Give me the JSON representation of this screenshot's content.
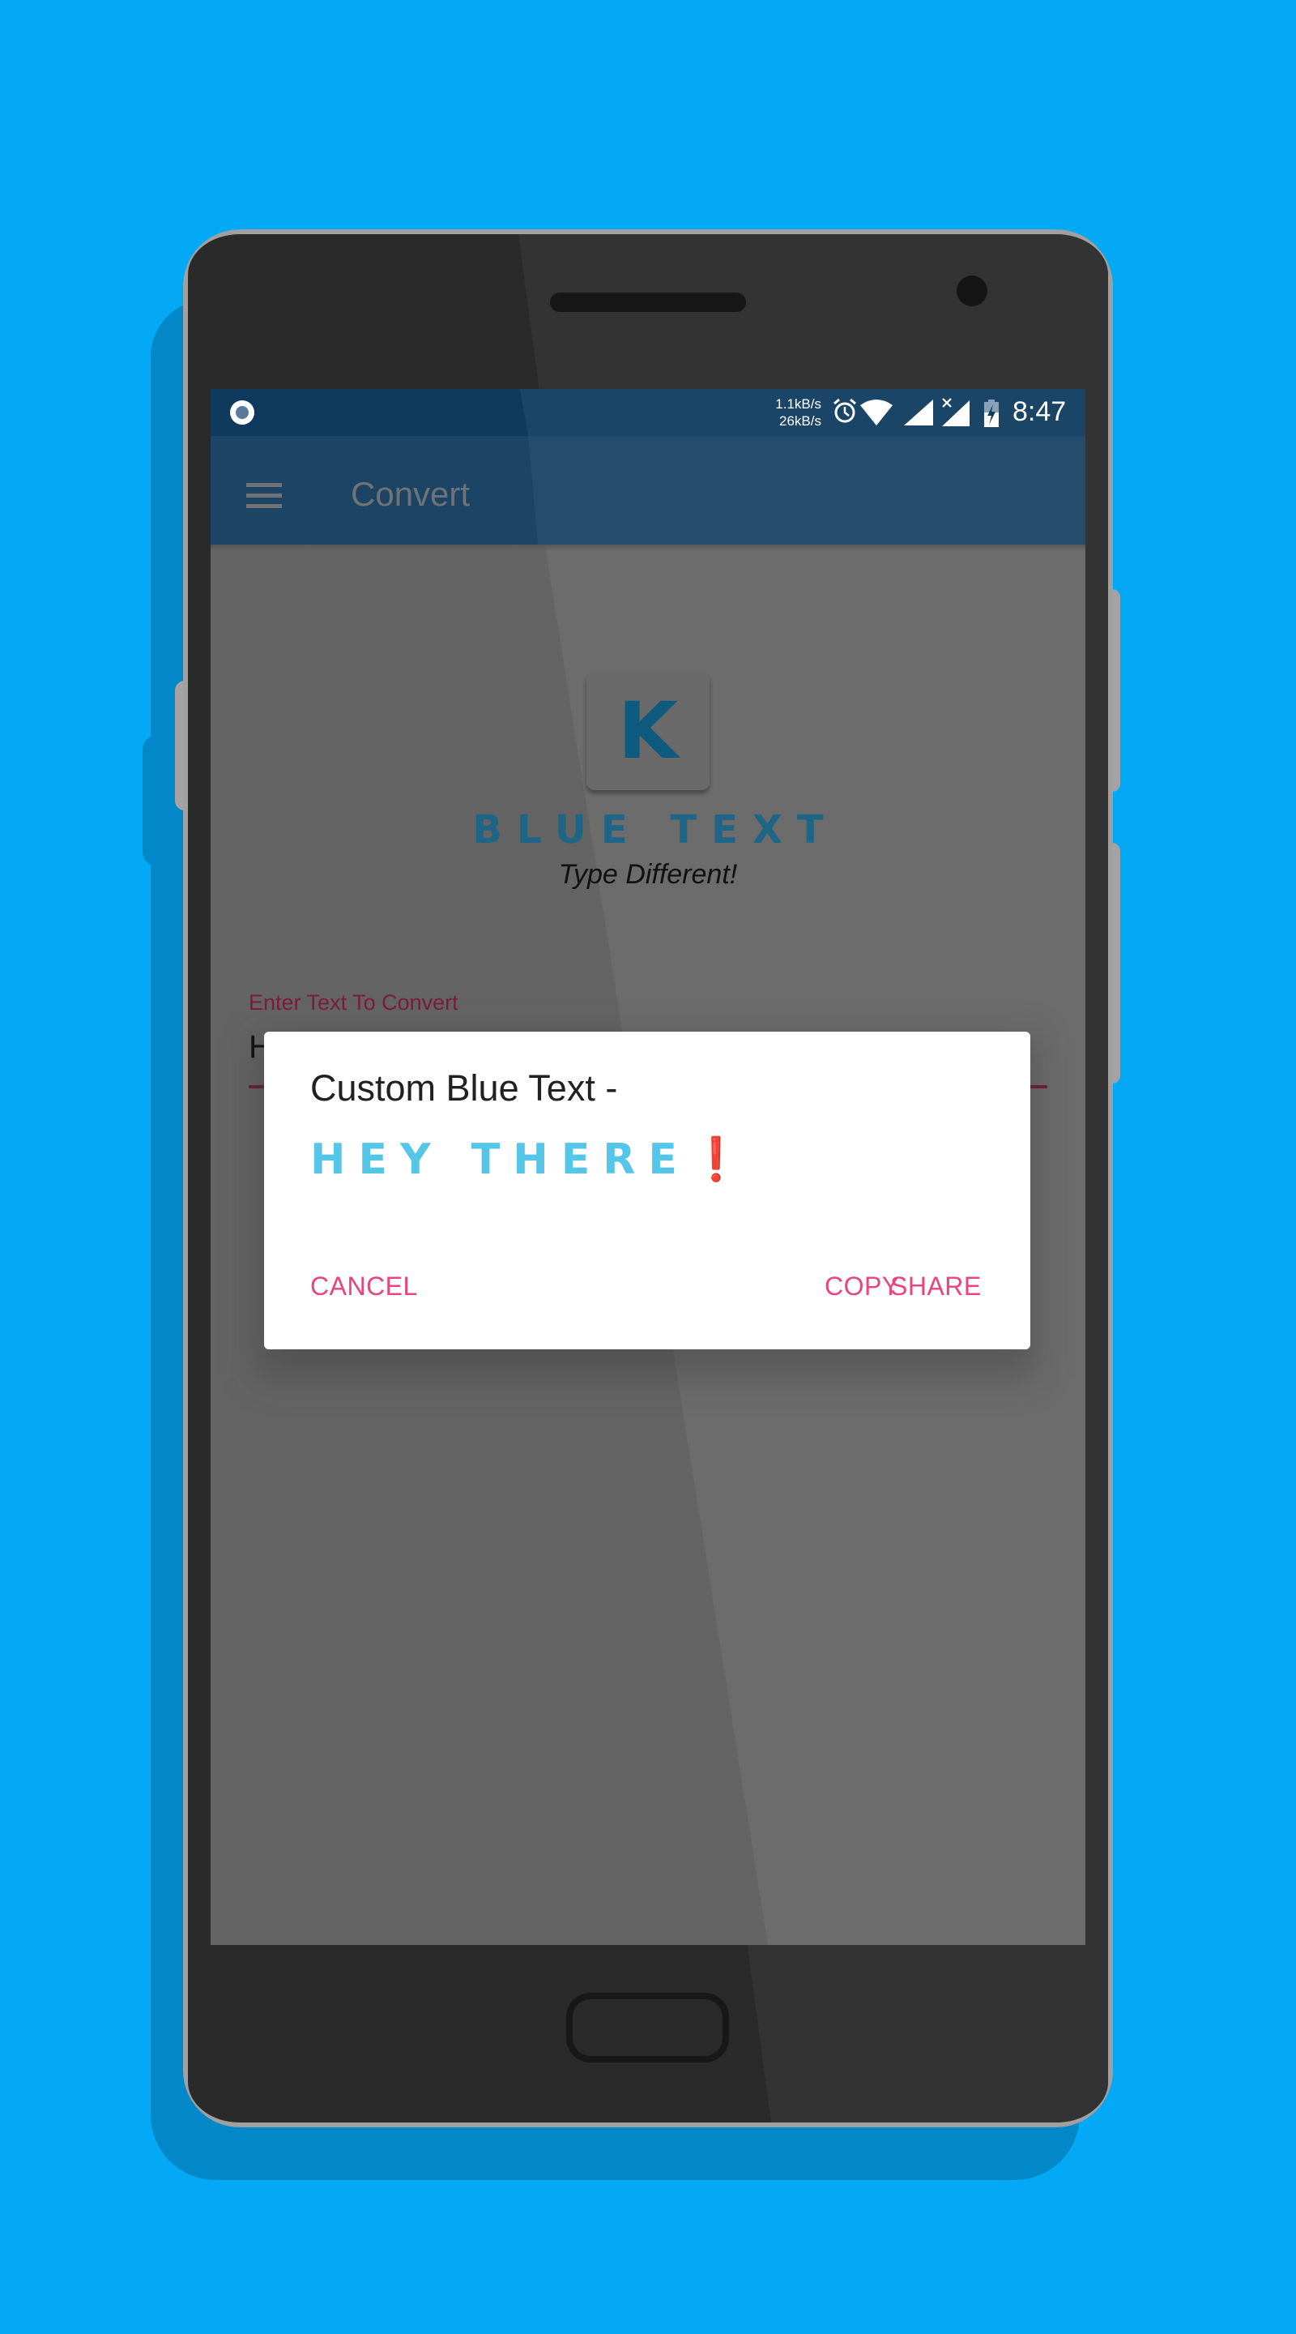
{
  "status_bar": {
    "net_up": "1.1kB/s",
    "net_down": "26kB/s",
    "time": "8:47",
    "icons": [
      "notification-icon",
      "alarm-icon",
      "wifi-icon",
      "signal-icon",
      "signal-no-data-icon",
      "battery-charging-icon"
    ]
  },
  "app_bar": {
    "menu_icon": "hamburger-menu-icon",
    "title": "Convert"
  },
  "logo": {
    "letter": "K",
    "name": "BLUE TEXT",
    "tagline": "Type Different!"
  },
  "input": {
    "label": "Enter Text To Convert",
    "value": "H"
  },
  "dialog": {
    "title": "Custom Blue Text -",
    "result": "HEY THERE",
    "result_suffix": "❗",
    "buttons": {
      "cancel": "CANCEL",
      "copy": "COPY",
      "share": "SHARE"
    }
  },
  "colors": {
    "background": "#03a9f4",
    "status_bar": "#0f3a5e",
    "app_bar": "#234c6d",
    "accent": "#e8457f",
    "result_text": "#56c6e8",
    "logo_blue": "#0f5a7f"
  }
}
